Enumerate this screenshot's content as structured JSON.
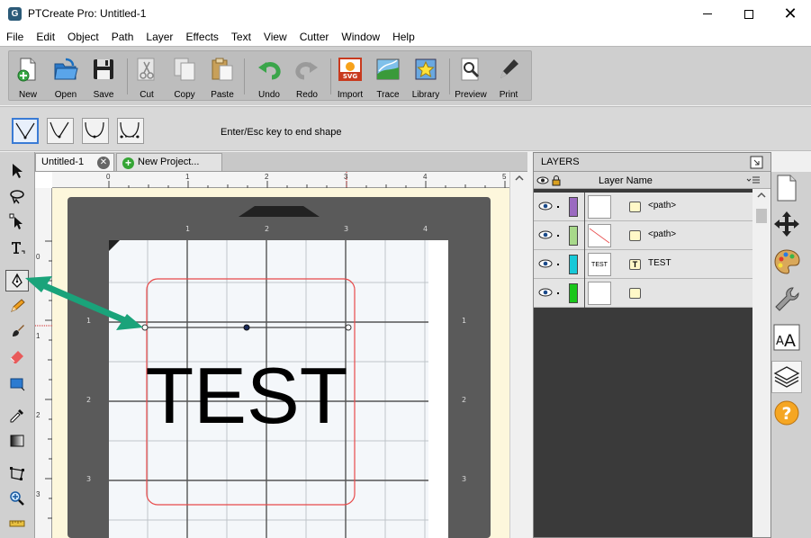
{
  "window": {
    "title": "PTCreate Pro: Untitled-1",
    "logo_letter": "G"
  },
  "menu": [
    "File",
    "Edit",
    "Object",
    "Path",
    "Layer",
    "Effects",
    "Text",
    "View",
    "Cutter",
    "Window",
    "Help"
  ],
  "toolbar": {
    "buttons": [
      {
        "label": "New",
        "icon": "new-doc-icon"
      },
      {
        "label": "Open",
        "icon": "open-folder-icon"
      },
      {
        "label": "Save",
        "icon": "floppy-icon"
      },
      {
        "label": "Cut",
        "icon": "scissors-icon"
      },
      {
        "label": "Copy",
        "icon": "copy-icon"
      },
      {
        "label": "Paste",
        "icon": "paste-icon"
      },
      {
        "label": "Undo",
        "icon": "undo-icon"
      },
      {
        "label": "Redo",
        "icon": "redo-icon"
      },
      {
        "label": "Import",
        "icon": "import-svg-icon"
      },
      {
        "label": "Trace",
        "icon": "trace-icon"
      },
      {
        "label": "Library",
        "icon": "library-icon"
      },
      {
        "label": "Preview",
        "icon": "magnifier-icon"
      },
      {
        "label": "Print",
        "icon": "pen-print-icon"
      }
    ],
    "import_badge": "SVG"
  },
  "shape_options": {
    "hint": "Enter/Esc key to end shape"
  },
  "tabs": {
    "active": "Untitled-1",
    "new": "New Project..."
  },
  "canvas": {
    "hruler": [
      "0",
      "1",
      "2",
      "3",
      "4",
      "5"
    ],
    "vruler": [
      "0",
      "1",
      "2",
      "3"
    ],
    "mat_top": [
      "1",
      "2",
      "3",
      "4"
    ],
    "mat_side": [
      "1",
      "2",
      "3"
    ],
    "text": "TEST"
  },
  "layers": {
    "title": "LAYERS",
    "column": "Layer Name",
    "rows": [
      {
        "name": "<path>",
        "color": "#9b6ac0",
        "type": "path"
      },
      {
        "name": "<path>",
        "color": "#a8d98a",
        "type": "path"
      },
      {
        "name": "TEST",
        "color": "#17c9d8",
        "type": "text",
        "thumb": "TEST"
      },
      {
        "name": "",
        "color": "#19c61a",
        "type": "path"
      }
    ]
  },
  "colors": {
    "accent": "#3a7bd5",
    "arrow": "#1aa37a",
    "cut_outline": "#e84a4a"
  }
}
